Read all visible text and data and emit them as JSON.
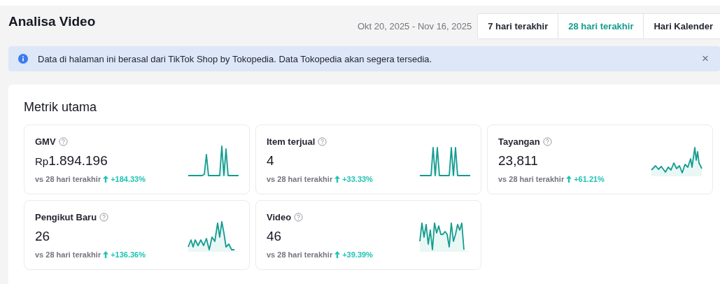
{
  "title": "Analisa Video",
  "date_range": "Okt 20, 2025 - Nov 16, 2025",
  "range_tabs": [
    {
      "label": "7 hari terakhir",
      "selected": false
    },
    {
      "label": "28 hari terakhir",
      "selected": true
    },
    {
      "label": "Hari Kalender",
      "selected": false
    }
  ],
  "banner": {
    "text": "Data di halaman ini berasal dari TikTok Shop by Tokopedia. Data Tokopedia akan segera tersedia.",
    "close": "×"
  },
  "section_title": "Metrik utama",
  "metrics": [
    {
      "label": "GMV",
      "prefix": "Rp",
      "value": "1.894.196",
      "compare": "vs 28 hari terakhir",
      "change": "+184.33%"
    },
    {
      "label": "Item terjual",
      "value": "4",
      "compare": "vs 28 hari terakhir",
      "change": "+33.33%"
    },
    {
      "label": "Tayangan",
      "value": "23,811",
      "compare": "vs 28 hari terakhir",
      "change": "+61.21%"
    },
    {
      "label": "Pengikut Baru",
      "value": "26",
      "compare": "vs 28 hari terakhir",
      "change": "+136.36%"
    },
    {
      "label": "Video",
      "value": "46",
      "compare": "vs 28 hari terakhir",
      "change": "+39.39%"
    }
  ]
}
